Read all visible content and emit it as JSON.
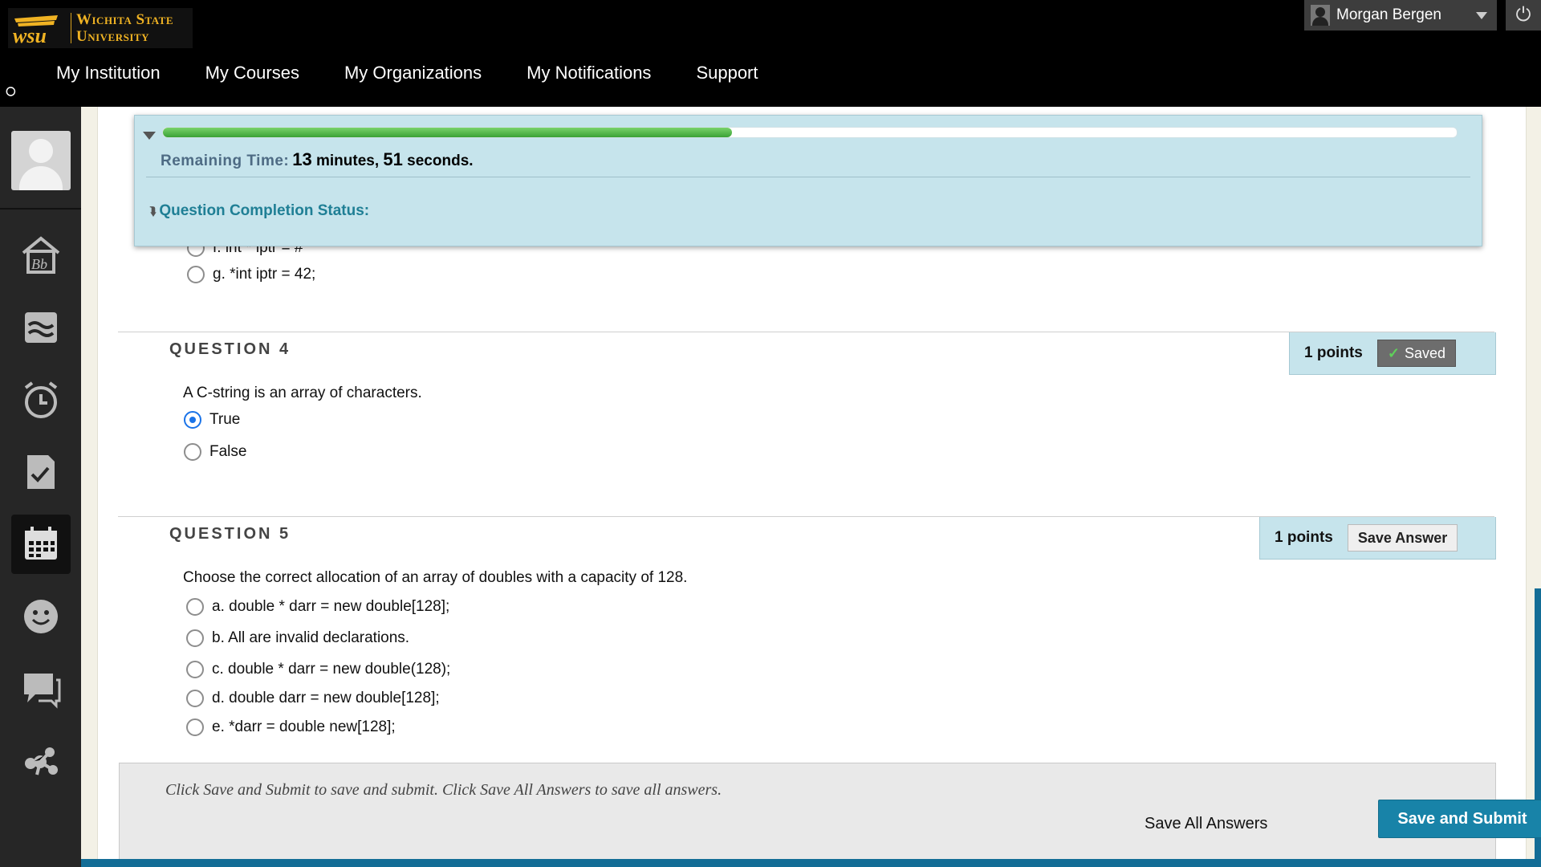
{
  "header": {
    "university_name_line1": "Wichita State",
    "university_name_line2": "University",
    "nav": [
      "My Institution",
      "My Courses",
      "My Organizations",
      "My Notifications",
      "Support"
    ],
    "user_name": "Morgan Bergen"
  },
  "sidebar": {
    "icons": [
      "avatar",
      "home-bb-icon",
      "stream-icon",
      "alarm-clock-icon",
      "grades-check-icon",
      "calendar-icon",
      "smiley-icon",
      "messages-icon",
      "tools-icon"
    ],
    "active": "calendar-icon"
  },
  "timer": {
    "label": "Remaining Time:",
    "minutes": "13",
    "minutes_word": " minutes, ",
    "seconds": "51",
    "seconds_word": " seconds.",
    "progress_fraction": 0.44,
    "completion_status_label": "Question Completion Status:"
  },
  "question3_partial": {
    "option_f": "f. int * iptr = #",
    "option_g": "g. *int iptr = 42;"
  },
  "question4": {
    "title": "QUESTION 4",
    "points": "1 points",
    "status_label": "Saved",
    "text": "A C-string is an array of characters.",
    "options": [
      "True",
      "False"
    ],
    "selected": "True"
  },
  "question5": {
    "title": "QUESTION 5",
    "points": "1 points",
    "save_label": "Save Answer",
    "text": "Choose the correct allocation of an array of doubles with a capacity of 128.",
    "options": [
      "a. double * darr = new double[128];",
      "b. All are invalid declarations.",
      "c. double * darr = new double(128);",
      "d. double darr = new double[128];",
      "e. *darr = double new[128];"
    ]
  },
  "footer": {
    "instructions": "Click Save and Submit to save and submit. Click Save All Answers to save all answers.",
    "save_all_label": "Save All Answers",
    "submit_label": "Save and Submit"
  }
}
